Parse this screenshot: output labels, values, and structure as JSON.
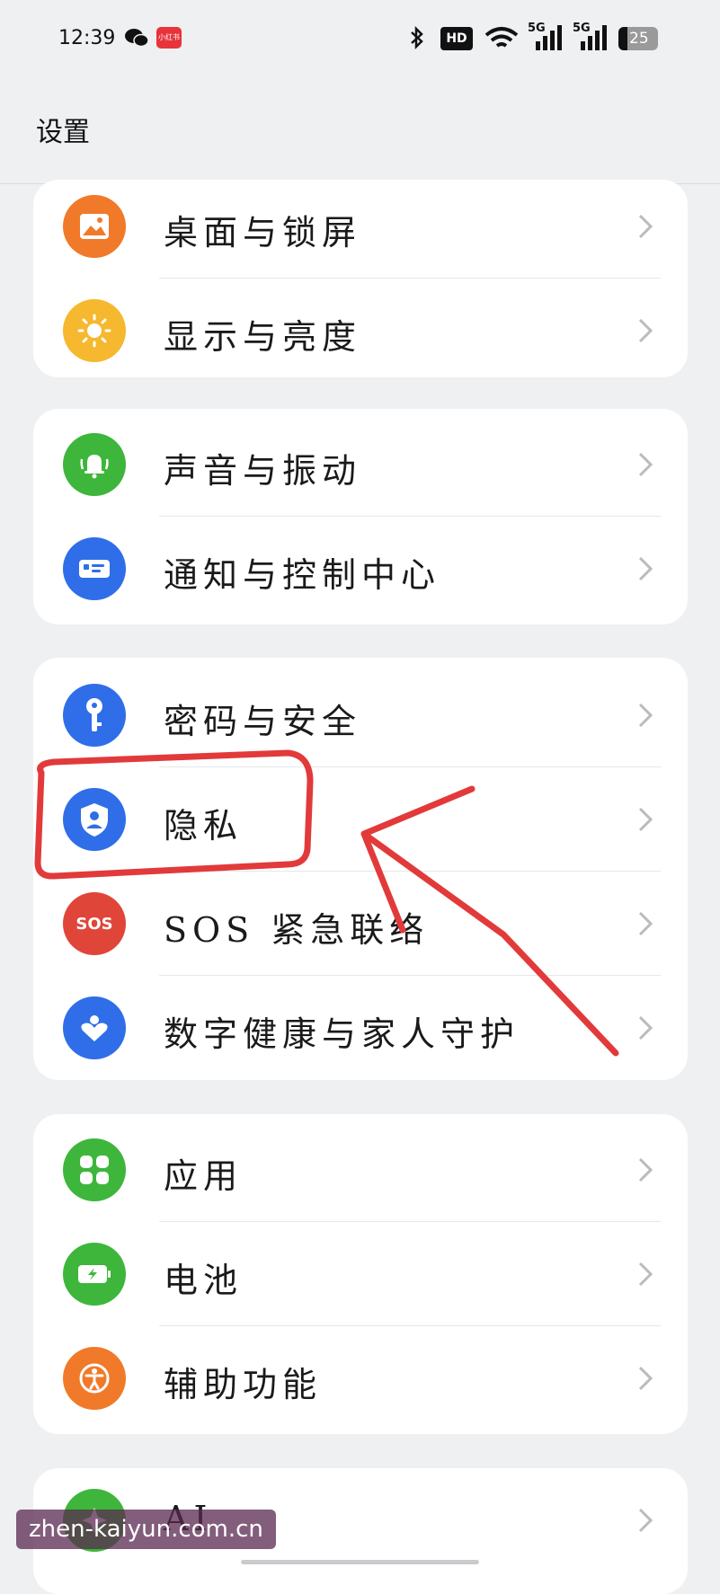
{
  "status_bar": {
    "time": "12:39",
    "app_badge": "小红书",
    "hd_label": "HD",
    "net1": "5G",
    "net2": "5G",
    "battery": "25"
  },
  "header": {
    "title": "设置"
  },
  "cards": [
    {
      "items": [
        {
          "label": "桌面与锁屏",
          "icon": "wallpaper-icon",
          "color": "#f07a2a"
        },
        {
          "label": "显示与亮度",
          "icon": "sun-icon",
          "color": "#f5b82e"
        }
      ]
    },
    {
      "items": [
        {
          "label": "声音与振动",
          "icon": "bell-icon",
          "color": "#3db63b"
        },
        {
          "label": "通知与控制中心",
          "icon": "notification-icon",
          "color": "#2f6ee8"
        }
      ]
    },
    {
      "items": [
        {
          "label": "密码与安全",
          "icon": "key-icon",
          "color": "#2f6ee8"
        },
        {
          "label": "隐私",
          "icon": "privacy-shield-icon",
          "color": "#2f6ee8"
        },
        {
          "label": "SOS 紧急联络",
          "icon": "sos-icon",
          "color": "#e0453a"
        },
        {
          "label": "数字健康与家人守护",
          "icon": "heart-icon",
          "color": "#2f6ee8"
        }
      ]
    },
    {
      "items": [
        {
          "label": "应用",
          "icon": "apps-grid-icon",
          "color": "#3db63b"
        },
        {
          "label": "电池",
          "icon": "battery-icon",
          "color": "#3db63b"
        },
        {
          "label": "辅助功能",
          "icon": "accessibility-icon",
          "color": "#f07a2a"
        }
      ]
    },
    {
      "items": [
        {
          "label": "AI",
          "icon": "ai-icon",
          "color": "#3db63b"
        }
      ]
    }
  ],
  "sos_icon_text": "SOS",
  "watermark": "zhen-kaiyun.com.cn"
}
